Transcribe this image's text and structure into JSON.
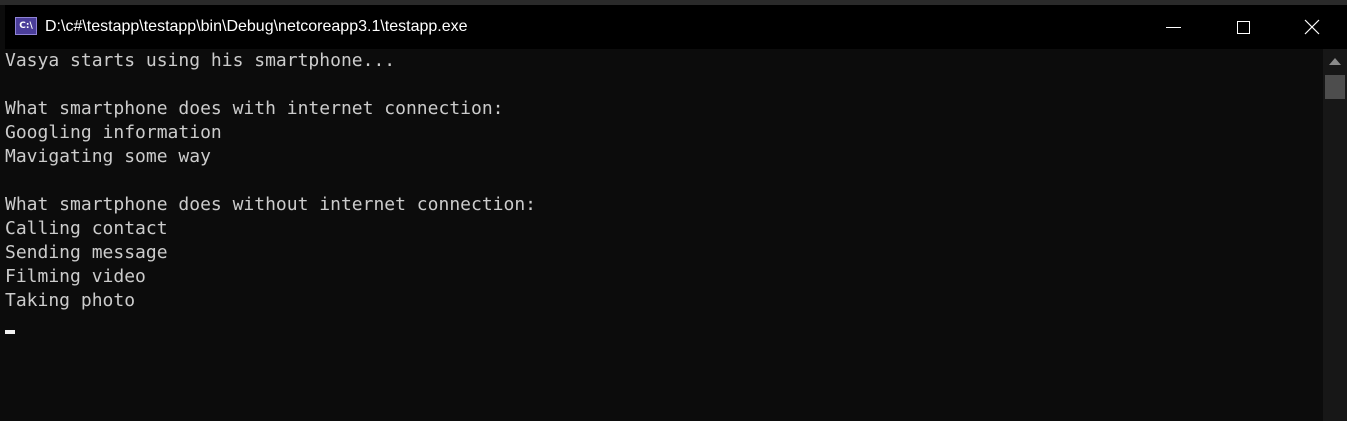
{
  "window": {
    "title": "D:\\c#\\testapp\\testapp\\bin\\Debug\\netcoreapp3.1\\testapp.exe",
    "app_icon_label": "C:\\",
    "icon_names": {
      "app": "console-app-icon",
      "minimize": "minimize-icon",
      "maximize": "maximize-icon",
      "close": "close-icon"
    },
    "close_glyph": "✕"
  },
  "console": {
    "lines": [
      "Vasya starts using his smartphone...",
      "",
      "What smartphone does with internet connection:",
      "Googling information",
      "Mavigating some way",
      "",
      "What smartphone does without internet connection:",
      "Calling contact",
      "Sending message",
      "Filming video",
      "Taking photo"
    ]
  },
  "colors": {
    "console_background": "#0c0c0c",
    "console_text": "#cccccc",
    "titlebar": "#000000"
  }
}
